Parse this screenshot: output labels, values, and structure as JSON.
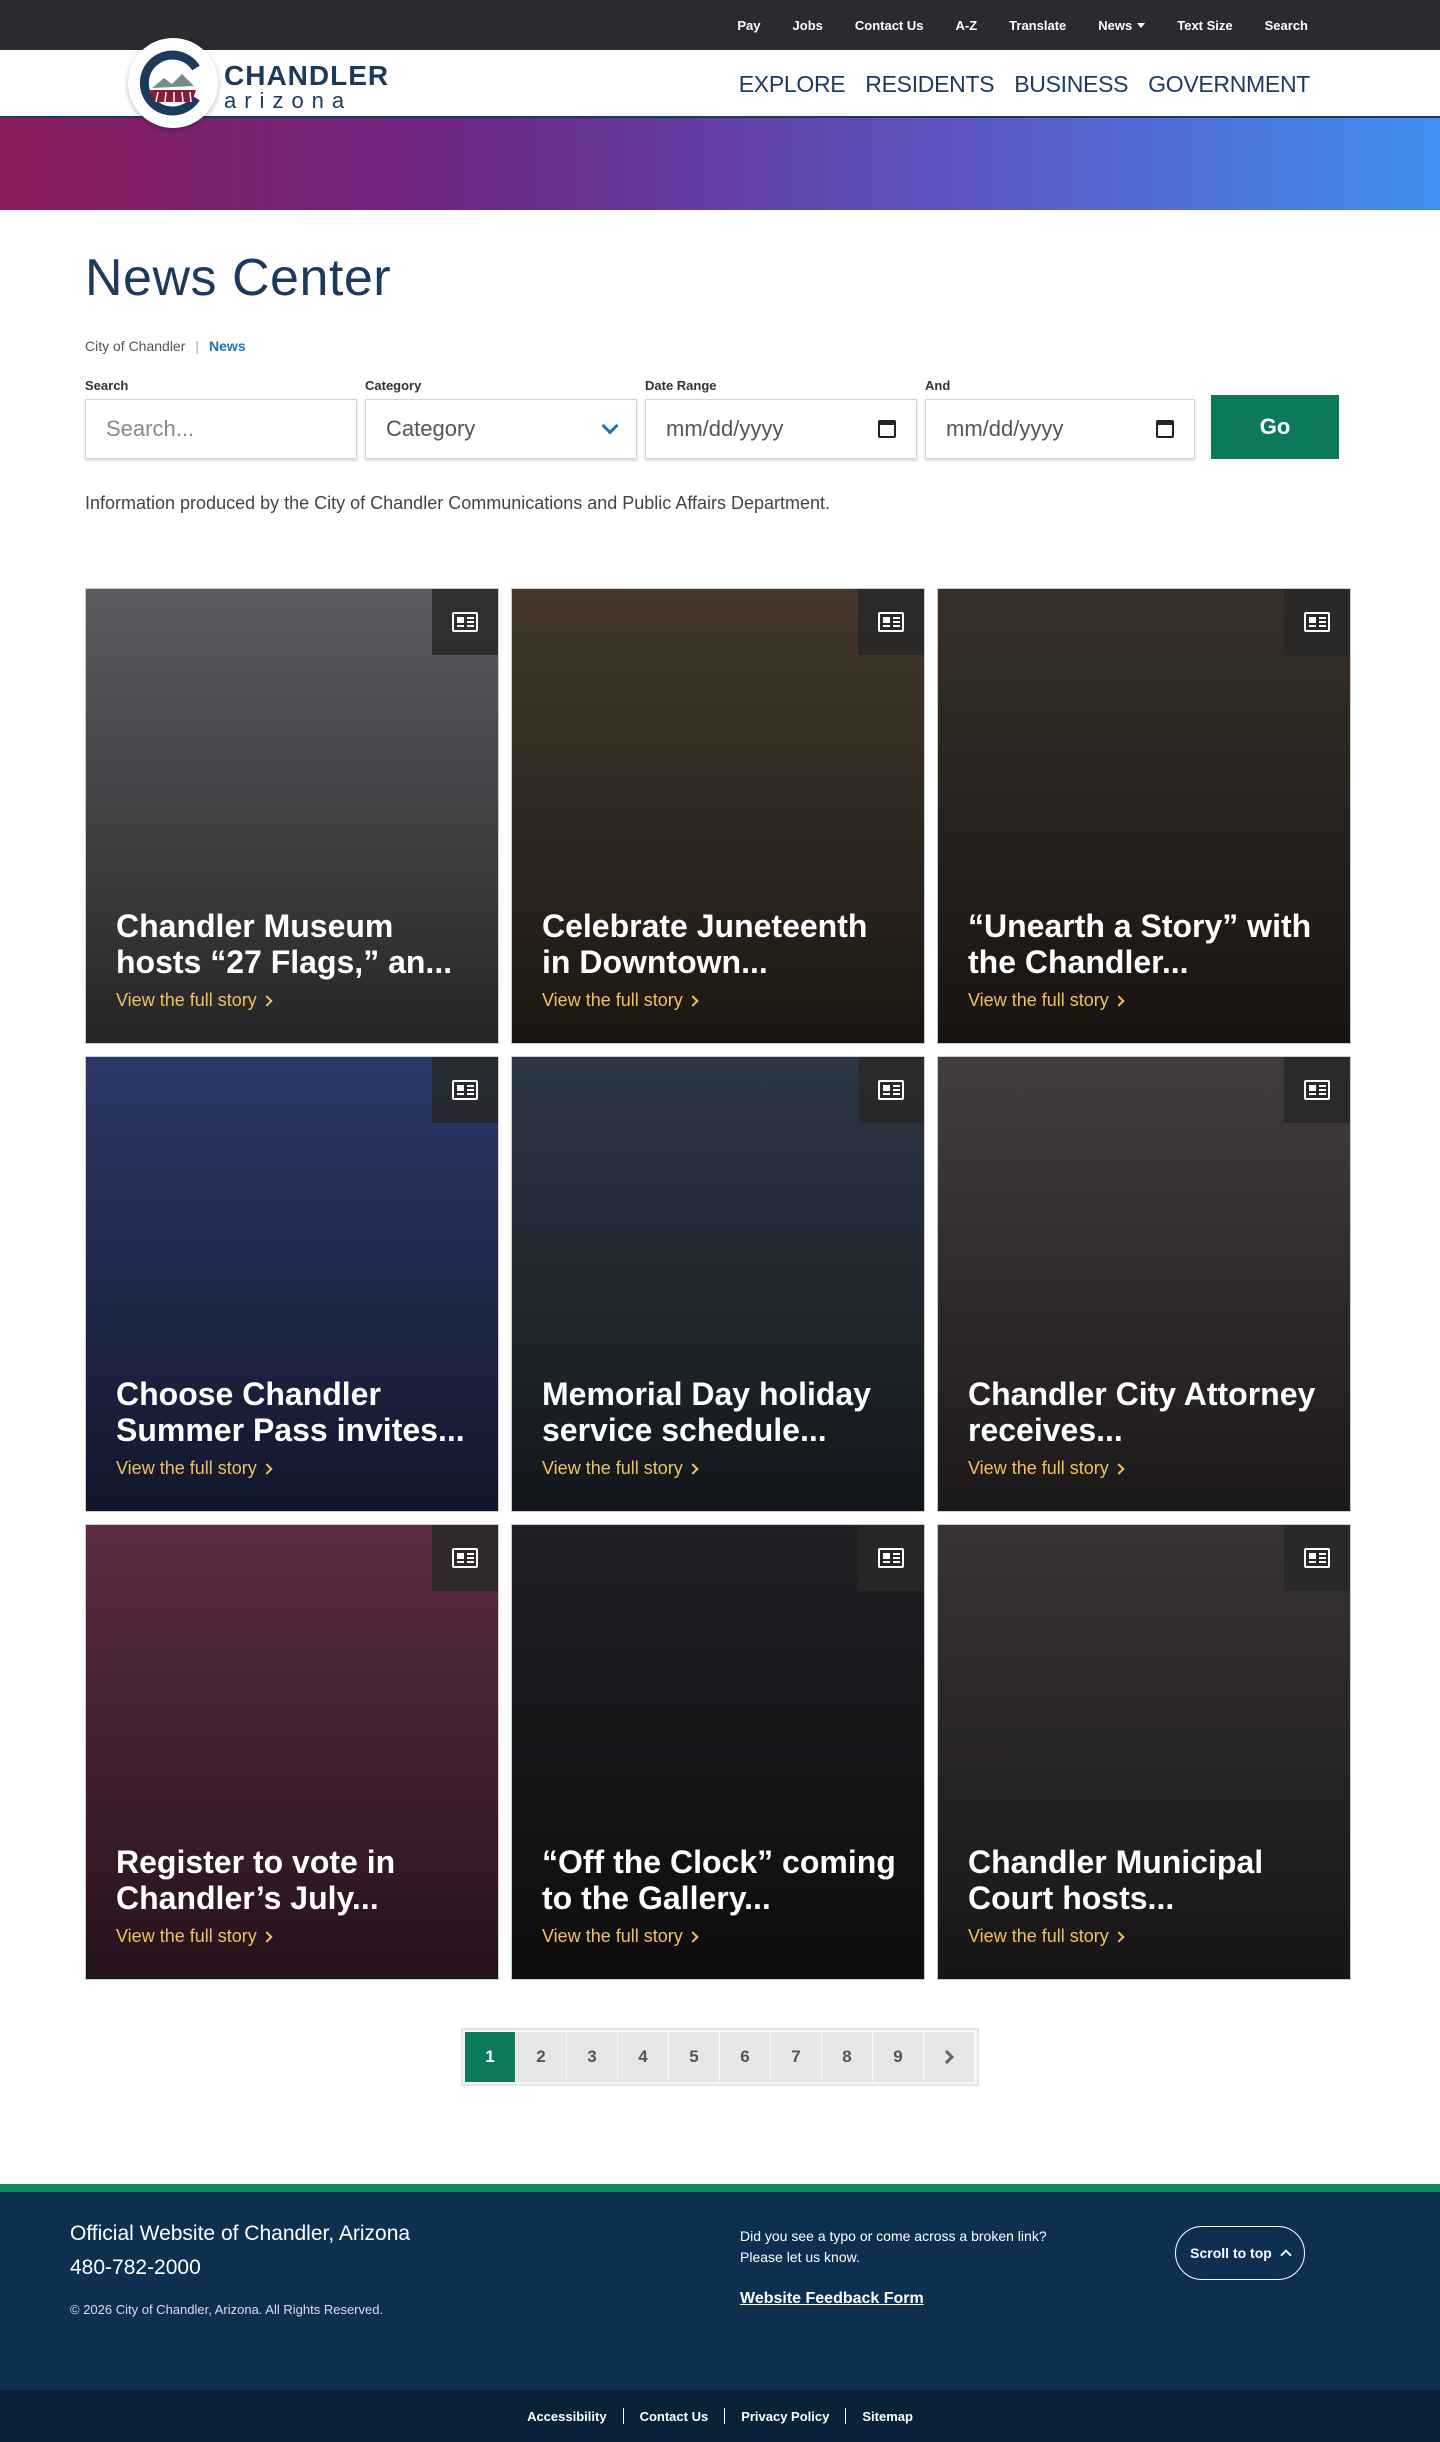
{
  "utility_nav": [
    "Pay",
    "Jobs",
    "Contact Us",
    "A-Z",
    "Translate",
    "News",
    "Text Size",
    "Search"
  ],
  "logo": {
    "line1": "CHANDLER",
    "line2": "arizona"
  },
  "main_nav": [
    "EXPLORE",
    "RESIDENTS",
    "BUSINESS",
    "GOVERNMENT"
  ],
  "page_title": "News Center",
  "breadcrumb": {
    "home": "City of Chandler",
    "current": "News"
  },
  "filters": {
    "search_label": "Search",
    "search_placeholder": "Search...",
    "category_label": "Category",
    "category_value": "Category",
    "date_label": "Date Range",
    "date_placeholder": "mm/dd/yyyy",
    "and_label": "And",
    "and_placeholder": "mm/dd/yyyy",
    "go_label": "Go"
  },
  "info_text": "Information produced by the City of Chandler Communications and Public Affairs Department.",
  "read_more": "View the full story",
  "cards": [
    {
      "title": "Chandler Museum hosts “27 Flags,” an...",
      "color": "#7a7a80"
    },
    {
      "title": "Celebrate Juneteenth in Downtown...",
      "color": "#5a4a3a"
    },
    {
      "title": "“Unearth a Story” with the Chandler...",
      "color": "#4a4038"
    },
    {
      "title": "Choose Chandler Summer Pass invites...",
      "color": "#3a4a8a"
    },
    {
      "title": "Memorial Day holiday service schedule...",
      "color": "#3a4a5a"
    },
    {
      "title": "Chandler City Attorney receives...",
      "color": "#5a5050"
    },
    {
      "title": "Register to vote in Chandler’s July...",
      "color": "#7a3a5a"
    },
    {
      "title": "“Off the Clock” coming to the Gallery...",
      "color": "#2a2a30"
    },
    {
      "title": "Chandler Municipal Court hosts...",
      "color": "#4a4448"
    }
  ],
  "pagination": [
    "1",
    "2",
    "3",
    "4",
    "5",
    "6",
    "7",
    "8",
    "9"
  ],
  "footer": {
    "site_title": "Official Website of Chandler, Arizona",
    "phone": "480-782-2000",
    "copyright": "© 2026 City of Chandler, Arizona. All Rights Reserved.",
    "typo_line1": "Did you see a typo or come across a broken link?",
    "typo_line2": "Please let us know.",
    "feedback_link": "Website Feedback Form",
    "scroll_top": "Scroll to top",
    "bottom_links": [
      "Accessibility",
      "Contact Us",
      "Privacy Policy",
      "Sitemap"
    ]
  },
  "colors": {
    "brand_navy": "#1c3a5e",
    "accent_green": "#0c7a5a",
    "link_blue": "#1f74b6",
    "read_more": "#f3c060"
  }
}
